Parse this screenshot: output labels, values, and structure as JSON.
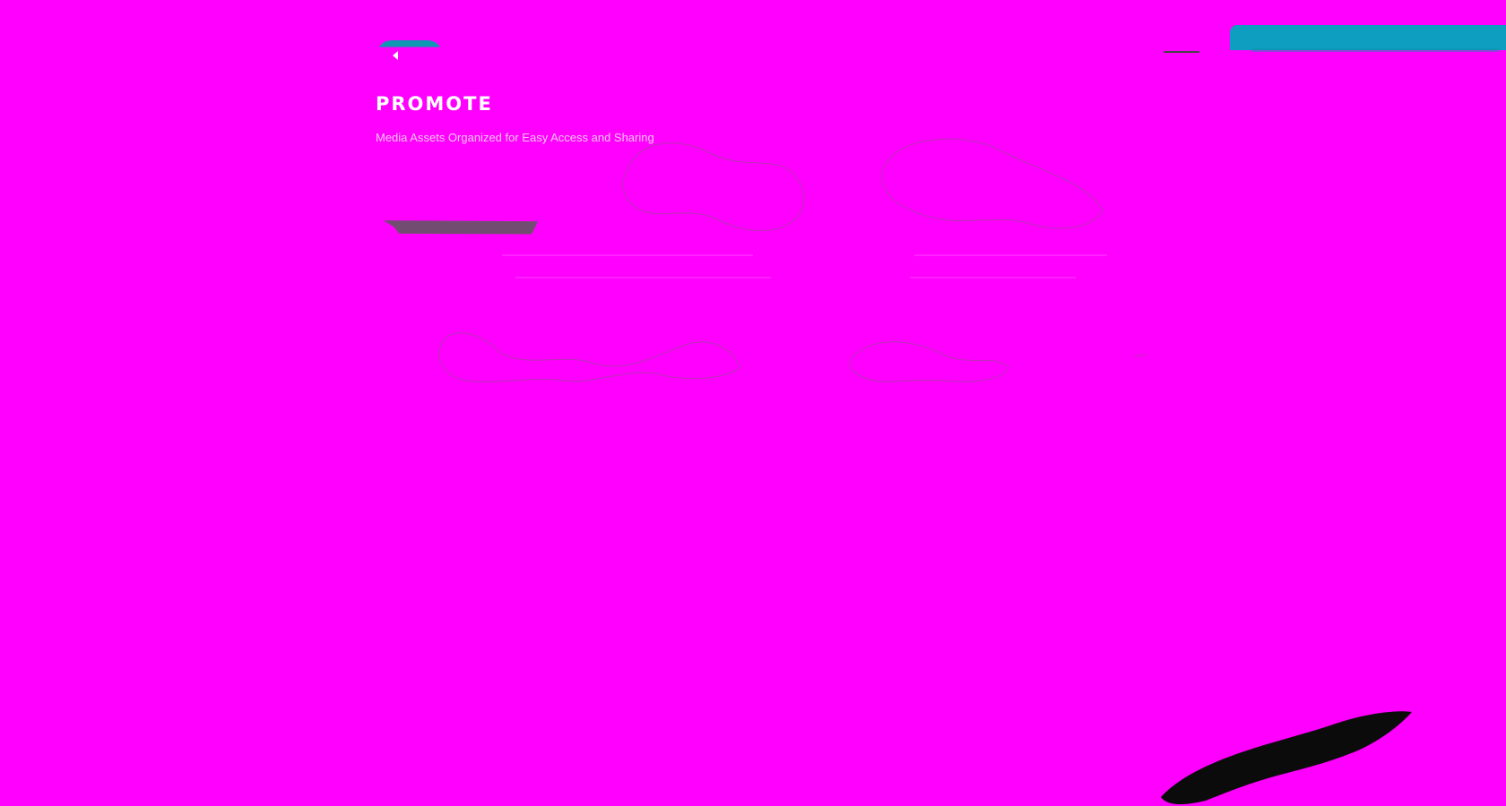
{
  "header": {
    "title": "PROMOTE",
    "subtitle": "Media Assets Organized for Easy Access and Sharing"
  },
  "colors": {
    "background": "#ff00ff",
    "accent": "#0f98b3",
    "text": "#ffffff"
  },
  "icons": {
    "back": "chevron-left-icon"
  }
}
